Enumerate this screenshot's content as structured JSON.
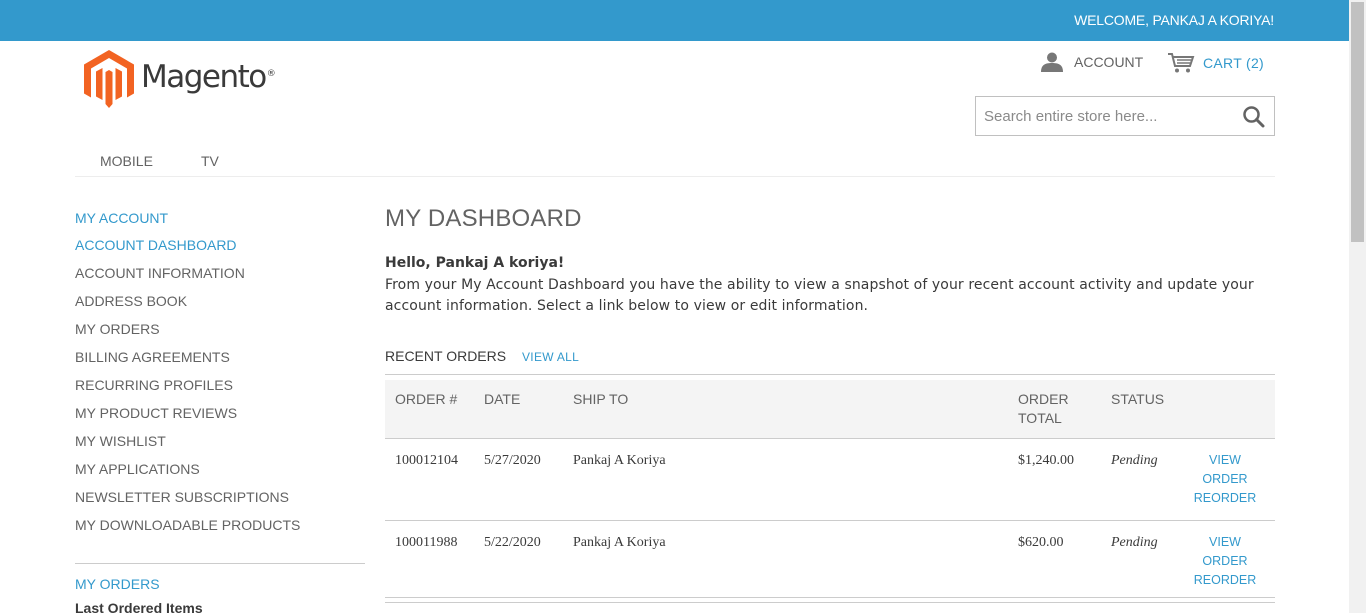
{
  "header": {
    "welcome": "WELCOME, PANKAJ A KORIYA!",
    "logo_text": "Magento",
    "logo_reg": "®",
    "account_label": "ACCOUNT",
    "cart_label": "CART (2)",
    "search_placeholder": "Search entire store here..."
  },
  "nav": {
    "items": [
      {
        "label": "MOBILE"
      },
      {
        "label": "TV"
      }
    ]
  },
  "sidebar": {
    "title": "MY ACCOUNT",
    "items": [
      {
        "label": "ACCOUNT DASHBOARD",
        "active": true
      },
      {
        "label": "ACCOUNT INFORMATION"
      },
      {
        "label": "ADDRESS BOOK"
      },
      {
        "label": "MY ORDERS"
      },
      {
        "label": "BILLING AGREEMENTS"
      },
      {
        "label": "RECURRING PROFILES"
      },
      {
        "label": "MY PRODUCT REVIEWS"
      },
      {
        "label": "MY WISHLIST"
      },
      {
        "label": "MY APPLICATIONS"
      },
      {
        "label": "NEWSLETTER SUBSCRIPTIONS"
      },
      {
        "label": "MY DOWNLOADABLE PRODUCTS"
      }
    ],
    "orders_title": "MY ORDERS",
    "last_ordered": "Last Ordered Items"
  },
  "main": {
    "title": "MY DASHBOARD",
    "hello": "Hello, Pankaj A koriya!",
    "intro": "From your My Account Dashboard you have the ability to view a snapshot of your recent account activity and update your account information. Select a link below to view or edit information.",
    "recent_orders": "RECENT ORDERS",
    "view_all": "VIEW ALL",
    "columns": {
      "order": "ORDER #",
      "date": "DATE",
      "ship_to": "SHIP TO",
      "order_total": "ORDER TOTAL",
      "status": "STATUS"
    },
    "orders": [
      {
        "order": "100012104",
        "date": "5/27/2020",
        "ship_to": "Pankaj A Koriya",
        "total": "$1,240.00",
        "status": "Pending",
        "view": "VIEW ORDER",
        "reorder": "REORDER"
      },
      {
        "order": "100011988",
        "date": "5/22/2020",
        "ship_to": "Pankaj A Koriya",
        "total": "$620.00",
        "status": "Pending",
        "view": "VIEW ORDER",
        "reorder": "REORDER"
      }
    ]
  },
  "colors": {
    "accent": "#3399cc",
    "logo_orange": "#f26322",
    "text": "#636363"
  },
  "icons": [
    "user-icon",
    "cart-icon",
    "search-icon",
    "magento-logo-icon"
  ]
}
